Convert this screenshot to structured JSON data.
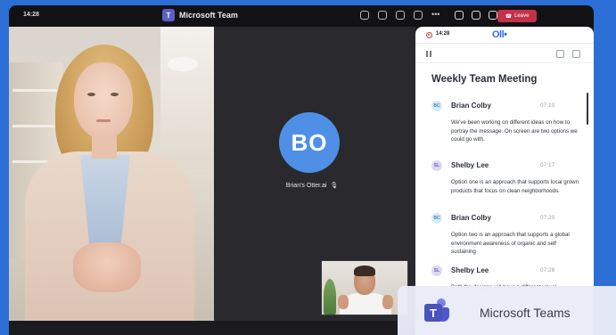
{
  "titlebar": {
    "time": "14:28",
    "app_title": "Microsoft Team",
    "leave_label": "Leave"
  },
  "video": {
    "participant_initials": "BO",
    "participant_name": "Brian's Otter.ai"
  },
  "notes_panel": {
    "recording_time": "14:28",
    "logo_text": "Oll•",
    "meeting_title": "Weekly Team Meeting",
    "messages": [
      {
        "initials": "BC",
        "name": "Brian Colby",
        "time": "07:10",
        "text": "We've been working on different ideas on how to portray the message. On screen are two options we could go with."
      },
      {
        "initials": "SL",
        "name": "Shelby Lee",
        "time": "07:17",
        "text": "Option one is an approach that supports local grown products that focus on clean neighborhoods."
      },
      {
        "initials": "BC",
        "name": "Brian Colby",
        "time": "07:20",
        "text": "Option two is an approach that supports a global environment awareness of organic and self sustaining"
      },
      {
        "initials": "SL",
        "name": "Shelby Lee",
        "time": "07:28",
        "text": "Both the designs will have a different visual"
      }
    ]
  },
  "badge": {
    "label": "Microsoft Teams"
  },
  "colors": {
    "background": "#2b6fd6",
    "avatar": "#4f8fe6",
    "leave": "#c4314b",
    "teams_brand": "#4b53bc"
  }
}
